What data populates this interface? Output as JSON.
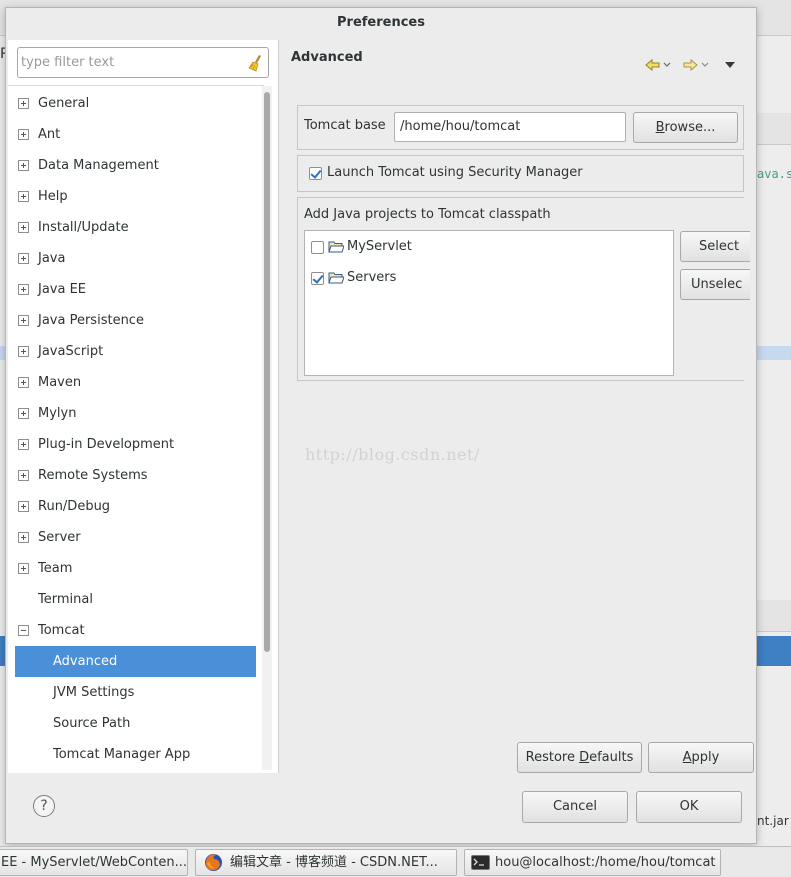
{
  "dialog": {
    "title": "Preferences"
  },
  "filter": {
    "placeholder": "type filter text"
  },
  "tree": {
    "items": [
      {
        "label": "General",
        "expander": "plus"
      },
      {
        "label": "Ant",
        "expander": "plus"
      },
      {
        "label": "Data Management",
        "expander": "plus"
      },
      {
        "label": "Help",
        "expander": "plus"
      },
      {
        "label": "Install/Update",
        "expander": "plus"
      },
      {
        "label": "Java",
        "expander": "plus"
      },
      {
        "label": "Java EE",
        "expander": "plus"
      },
      {
        "label": "Java Persistence",
        "expander": "plus"
      },
      {
        "label": "JavaScript",
        "expander": "plus"
      },
      {
        "label": "Maven",
        "expander": "plus"
      },
      {
        "label": "Mylyn",
        "expander": "plus"
      },
      {
        "label": "Plug-in Development",
        "expander": "plus"
      },
      {
        "label": "Remote Systems",
        "expander": "plus"
      },
      {
        "label": "Run/Debug",
        "expander": "plus"
      },
      {
        "label": "Server",
        "expander": "plus"
      },
      {
        "label": "Team",
        "expander": "plus"
      },
      {
        "label": "Terminal",
        "expander": "none"
      },
      {
        "label": "Tomcat",
        "expander": "minus"
      },
      {
        "label": "Advanced",
        "expander": "child",
        "selected": true
      },
      {
        "label": "JVM Settings",
        "expander": "child"
      },
      {
        "label": "Source Path",
        "expander": "child"
      },
      {
        "label": "Tomcat Manager App",
        "expander": "child"
      }
    ]
  },
  "page": {
    "title": "Advanced",
    "tomcat_base_label": "Tomcat base",
    "tomcat_base_value": "/home/hou/tomcat",
    "browse_label": "Browse...",
    "security_label": "Launch Tomcat using Security Manager",
    "security_checked": true,
    "classpath_label": "Add Java projects to Tomcat classpath",
    "projects": [
      {
        "name": "MyServlet",
        "checked": false
      },
      {
        "name": "Servers",
        "checked": true
      }
    ],
    "select_label": "Select",
    "unselect_label": "Unselec",
    "watermark": "http://blog.csdn.net/",
    "restore_label": "Restore Defaults",
    "apply_label": "Apply"
  },
  "footer": {
    "help_icon": "?",
    "cancel_label": "Cancel",
    "ok_label": "OK"
  },
  "background": {
    "r_fragment": "R",
    "code_fragment": "ava.s",
    "jar_fragment": "nt.jar"
  },
  "taskbar": {
    "items": [
      {
        "label": "EE - MyServlet/WebConten..."
      },
      {
        "label": "编辑文章 - 博客频道 - CSDN.NET..."
      },
      {
        "label": "hou@localhost:/home/hou/tomcat"
      }
    ]
  },
  "colors": {
    "selection": "#4a90d9",
    "check": "#2f6ec0"
  }
}
